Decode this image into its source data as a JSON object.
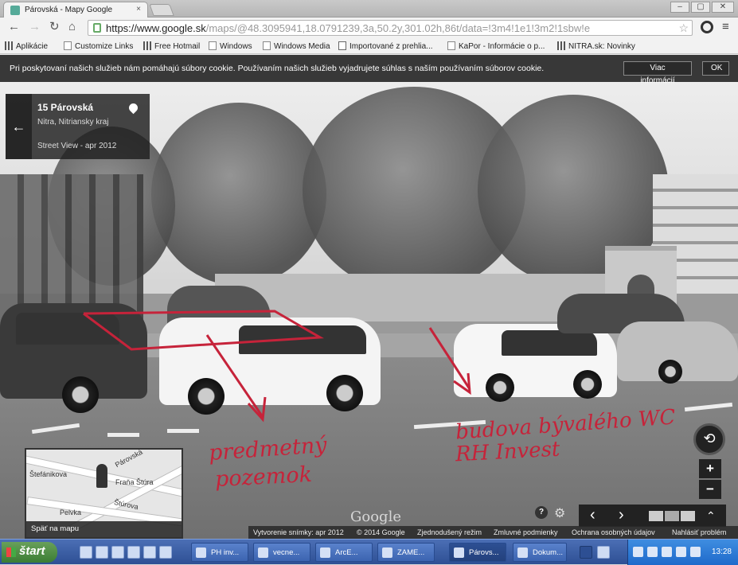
{
  "browser": {
    "tab_title": "Párovská - Mapy Google",
    "tab_close": "×",
    "url_host": "https://www.google.sk",
    "url_path": "/maps/@48.3095941,18.0791239,3a,50.2y,301.02h,86t/data=!3m4!1e1!3m2!1sbw!e",
    "win_controls": [
      "–",
      "▢",
      "✕"
    ]
  },
  "bookmarks": [
    {
      "label": "Aplikácie",
      "icon": "apps-grid-icon"
    },
    {
      "label": "Customize Links",
      "icon": "page-icon"
    },
    {
      "label": "Free Hotmail",
      "icon": "msn-icon"
    },
    {
      "label": "Windows",
      "icon": "page-icon"
    },
    {
      "label": "Windows Media",
      "icon": "page-icon"
    },
    {
      "label": "Importované z prehlia...",
      "icon": "folder-icon"
    },
    {
      "label": "KaPor - Informácie o p...",
      "icon": "page-icon"
    },
    {
      "label": "NITRA.sk: Novinky",
      "icon": "nitra-icon"
    }
  ],
  "cookie_bar": {
    "text": "Pri poskytovaní našich služieb nám pomáhajú súbory cookie. Používaním našich služieb vyjadrujete súhlas s naším používaním súborov cookie.",
    "more_info": "Viac informácií",
    "ok": "OK"
  },
  "location": {
    "back": "←",
    "title": "15 Párovská",
    "subtitle": "Nitra, Nitriansky kraj",
    "date": "Street View - apr 2012"
  },
  "minimap": {
    "labels": [
      "Párovská",
      "Štefánikova",
      "Fraňa Štúra",
      "Štúrova",
      "Pelvka"
    ],
    "back_label": "Späť na mapu"
  },
  "controls": {
    "compass": "⟲",
    "zoom_in": "+",
    "zoom_out": "−",
    "prev": "‹",
    "next": "›",
    "expand": "⌃",
    "help": "?",
    "watermark": "Google"
  },
  "footer": {
    "capture": "Vytvorenie snímky: apr 2012",
    "copyright": "© 2014 Google",
    "mode": "Zjednodušený režim",
    "terms": "Zmluvné podmienky",
    "privacy": "Ochrana osobných údajov",
    "report": "Nahlásiť problém"
  },
  "annotations": {
    "left_line1": "predmetný",
    "left_line2": "pozemok",
    "right_line1": "budova bývalého WC",
    "right_line2": "RH Invest"
  },
  "taskbar": {
    "start": "štart",
    "items": [
      "PH inv...",
      "vecne...",
      "ArcE...",
      "ZAME...",
      "Párovs...",
      "Dokum..."
    ],
    "active_index": 4,
    "clock": "13:28"
  },
  "colors": {
    "annotation_red": "#c6233a",
    "taskbar_blue": "#2e4f94",
    "start_green": "#3b7d34"
  }
}
